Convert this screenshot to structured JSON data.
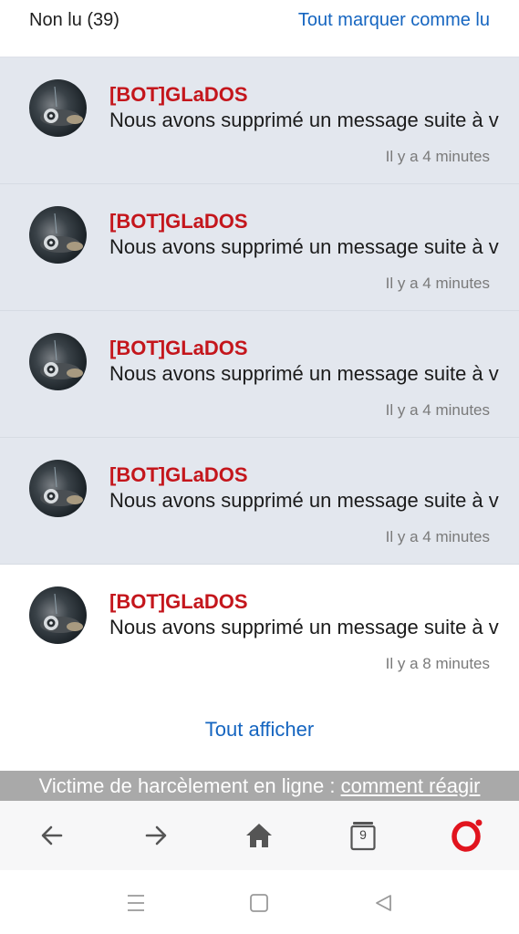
{
  "header": {
    "unread_label": "Non lu (39)",
    "mark_all_label": "Tout marquer comme lu"
  },
  "notifications": [
    {
      "author": "[BOT]GLaDOS",
      "message": "Nous avons supprimé un message suite à v",
      "time": "Il y a 4 minutes",
      "unread": true
    },
    {
      "author": "[BOT]GLaDOS",
      "message": "Nous avons supprimé un message suite à v",
      "time": "Il y a 4 minutes",
      "unread": true
    },
    {
      "author": "[BOT]GLaDOS",
      "message": "Nous avons supprimé un message suite à v",
      "time": "Il y a 4 minutes",
      "unread": true
    },
    {
      "author": "[BOT]GLaDOS",
      "message": "Nous avons supprimé un message suite à v",
      "time": "Il y a 4 minutes",
      "unread": true
    },
    {
      "author": "[BOT]GLaDOS",
      "message": "Nous avons supprimé un message suite à v",
      "time": "Il y a 8 minutes",
      "unread": false
    }
  ],
  "footer": {
    "show_all_label": "Tout afficher"
  },
  "banner": {
    "text": "Victime de harcèlement en ligne : ",
    "link": "comment réagir"
  },
  "browser_bar": {
    "tab_count": "9",
    "icons": [
      "back-arrow-icon",
      "forward-arrow-icon",
      "home-icon",
      "tabs-icon",
      "opera-menu-icon"
    ]
  },
  "system_nav": {
    "icons": [
      "recents-icon",
      "home-square-icon",
      "back-triangle-icon"
    ]
  },
  "colors": {
    "author": "#c4161c",
    "link": "#1565c0",
    "unread_bg": "#e3e7ee",
    "banner_bg": "#a9a9a9",
    "opera_red": "#e1141e"
  }
}
